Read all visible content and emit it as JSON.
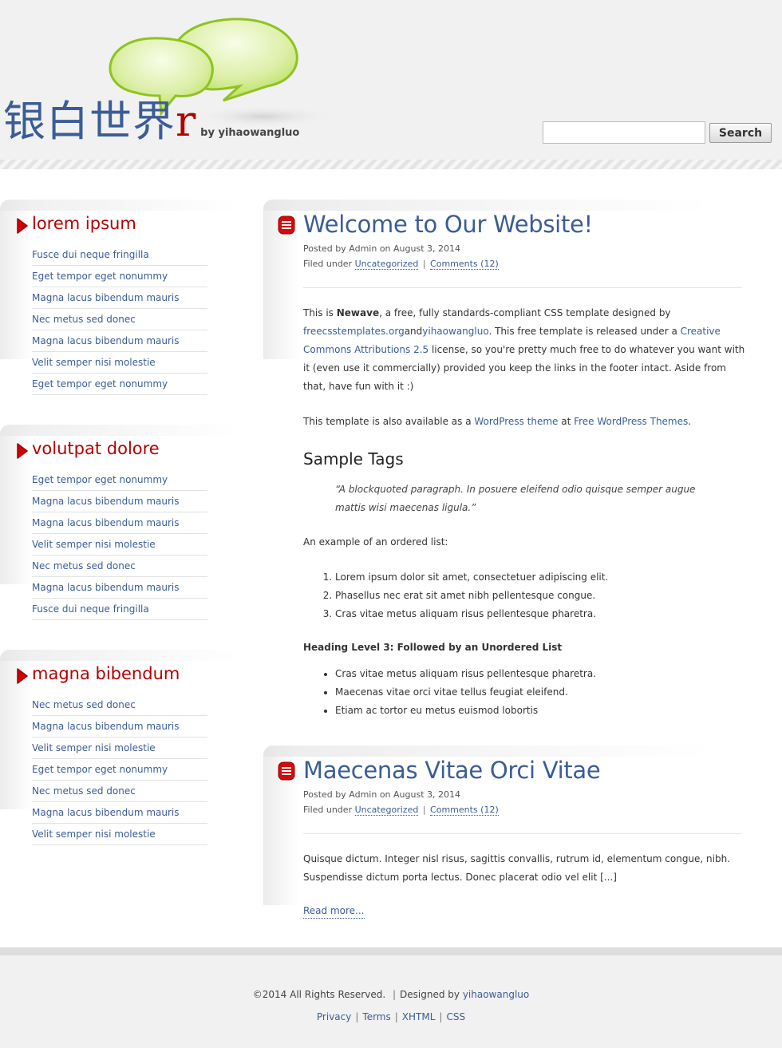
{
  "header": {
    "logo_cn": "银白世界",
    "logo_r": "r",
    "logo_by": "by yihaowangluo",
    "search_placeholder": "",
    "search_button": "Search"
  },
  "sidebar": [
    {
      "title": "lorem ipsum",
      "items": [
        "Fusce dui neque fringilla",
        "Eget tempor eget nonummy",
        "Magna lacus bibendum mauris",
        "Nec metus sed donec",
        "Magna lacus bibendum mauris",
        "Velit semper nisi molestie",
        "Eget tempor eget nonummy"
      ]
    },
    {
      "title": "volutpat dolore",
      "items": [
        "Eget tempor eget nonummy",
        "Magna lacus bibendum mauris",
        "Magna lacus bibendum mauris",
        "Velit semper nisi molestie",
        "Nec metus sed donec",
        "Magna lacus bibendum mauris",
        "Fusce dui neque fringilla"
      ]
    },
    {
      "title": "magna bibendum",
      "items": [
        "Nec metus sed donec",
        "Magna lacus bibendum mauris",
        "Velit semper nisi molestie",
        "Eget tempor eget nonummy",
        "Nec metus sed donec",
        "Magna lacus bibendum mauris",
        "Velit semper nisi molestie"
      ]
    }
  ],
  "post1": {
    "title": "Welcome to Our Website!",
    "posted_by_prefix": "Posted by",
    "author": "Admin",
    "date": "on August 3, 2014",
    "filed_under": "Filed under",
    "category": "Uncategorized",
    "comments": "Comments (12)",
    "intro": {
      "t1": "This is ",
      "brand": "Newave",
      "t2": ", a free, fully standards-compliant CSS template designed by ",
      "link1": "freecsstemplates.org",
      "t3": "and",
      "link2": "yihaowangluo",
      "t4": ". This free template is released under a ",
      "link3": "Creative Commons Attributions 2.5",
      "t5": " license, so you're pretty much free to do whatever you want with it (even use it commercially) provided you keep the links in the footer intact. Aside from that, have fun with it :)"
    },
    "also": {
      "t1": "This template is also available as a ",
      "link1": "WordPress theme",
      "t2": " at ",
      "link2": "Free WordPress Themes",
      "t3": "."
    },
    "sample_tags": "Sample Tags",
    "blockquote": "“A blockquoted paragraph. In posuere eleifend odio quisque semper augue mattis wisi maecenas ligula.”",
    "ol_intro": "An example of an ordered list:",
    "ol": [
      "Lorem ipsum dolor sit amet, consectetuer adipiscing elit.",
      "Phasellus nec erat sit amet nibh pellentesque congue.",
      "Cras vitae metus aliquam risus pellentesque pharetra."
    ],
    "h3": "Heading Level 3: Followed by an Unordered List",
    "ul": [
      "Cras vitae metus aliquam risus pellentesque pharetra.",
      "Maecenas vitae orci vitae tellus feugiat eleifend.",
      "Etiam ac tortor eu metus euismod lobortis"
    ]
  },
  "post2": {
    "title": "Maecenas Vitae Orci Vitae",
    "posted_by_prefix": "Posted by",
    "author": "Admin",
    "date": "on August 3, 2014",
    "filed_under": "Filed under",
    "category": "Uncategorized",
    "comments": "Comments (12)",
    "body": "Quisque dictum. Integer nisl risus, sagittis convallis, rutrum id, elementum congue, nibh. Suspendisse dictum porta lectus. Donec placerat odio vel elit [...]",
    "read_more": "Read more..."
  },
  "footer": {
    "copyright": "©2014 All Rights Reserved.",
    "designed_by": "Designed by",
    "designer": "yihaowangluo",
    "links": [
      "Privacy",
      "Terms",
      "XHTML",
      "CSS"
    ]
  },
  "colors": {
    "accent_blue": "#3a5d96",
    "accent_red": "#b40000",
    "bubble_green": "#8fc31f"
  }
}
